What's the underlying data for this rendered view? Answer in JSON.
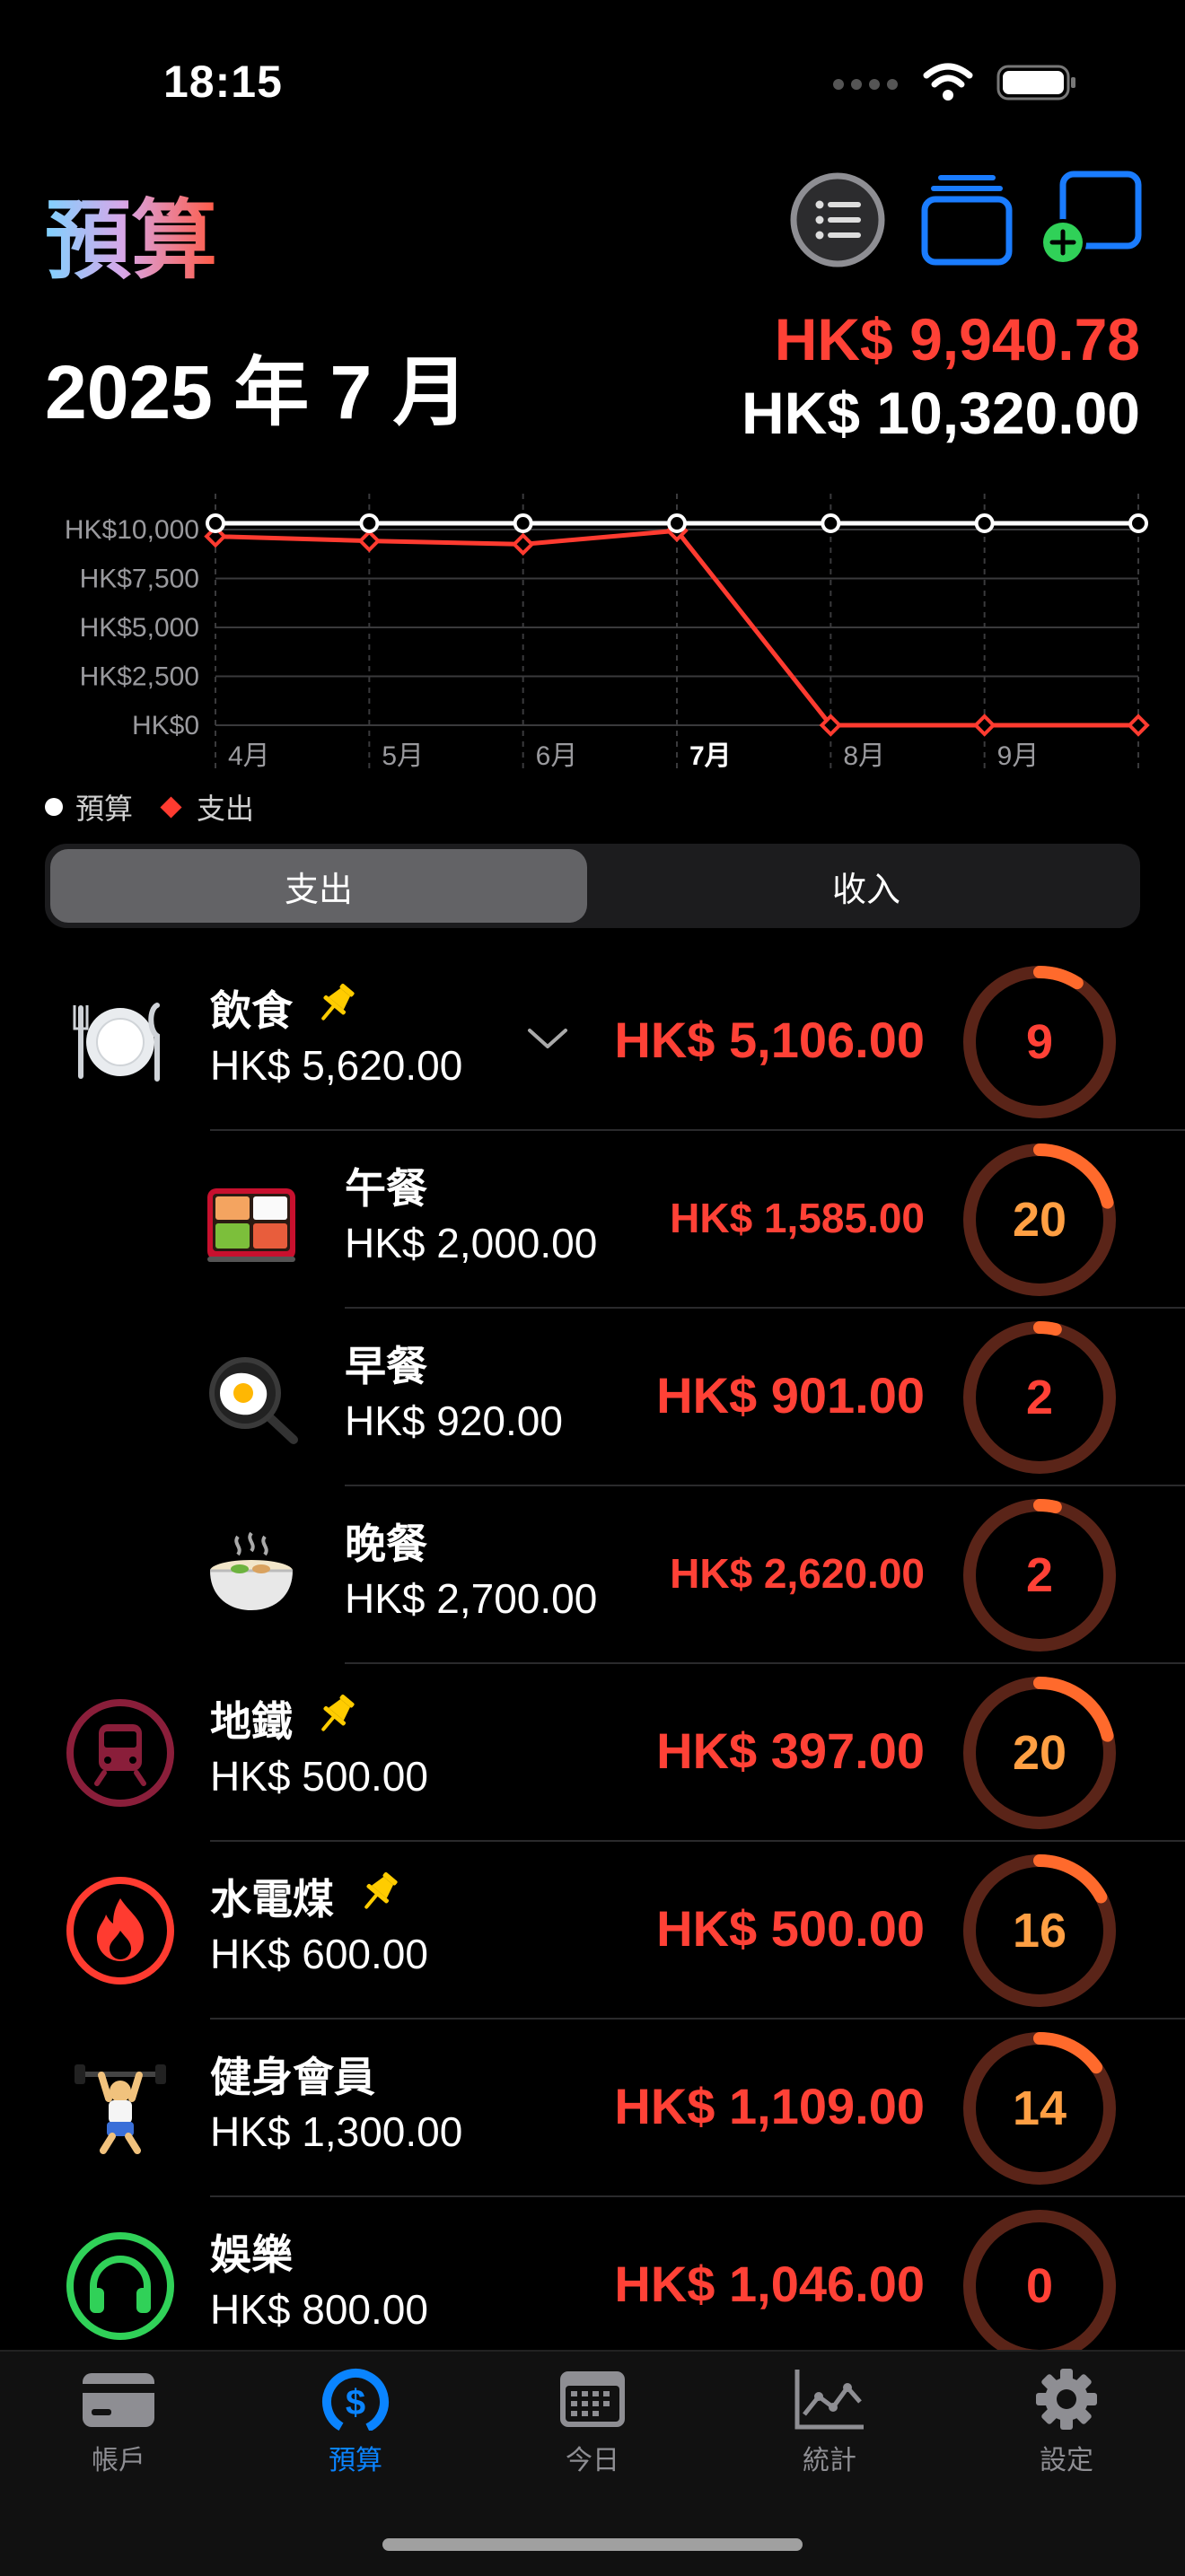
{
  "status": {
    "time": "18:15"
  },
  "header": {
    "title": "預算",
    "month": "2025 年 7 月",
    "spent_total": "HK$ 9,940.78",
    "budget_total": "HK$ 10,320.00",
    "buttons": {
      "list": "list-icon",
      "cards": "stack-icon",
      "add": "add-window-icon"
    }
  },
  "colors": {
    "accent": "#0a84ff",
    "spent": "#ff4136",
    "ring_track": "#5a2418",
    "ring_fg": "#ff6a2c",
    "bg": "#000000"
  },
  "chart_data": {
    "type": "line",
    "categories": [
      "4月",
      "5月",
      "6月",
      "7月",
      "8月",
      "9月"
    ],
    "series": [
      {
        "name": "預算",
        "values": [
          10320,
          10320,
          10320,
          10320,
          10320,
          10320,
          10320
        ],
        "color": "#ffffff"
      },
      {
        "name": "支出",
        "values": [
          9650,
          9420,
          9250,
          9940.78,
          0,
          0,
          0
        ],
        "color": "#ff3b30"
      }
    ],
    "y_ticks": [
      "HK$10,000",
      "HK$7,500",
      "HK$5,000",
      "HK$2,500",
      "HK$0"
    ],
    "ylim": [
      0,
      10000
    ],
    "highlight_category": "7月",
    "grid": true
  },
  "legend": {
    "budget": "預算",
    "spent": "支出"
  },
  "segment": {
    "expense": "支出",
    "income": "收入",
    "selected": "支出"
  },
  "categories": [
    {
      "name": "飲食",
      "budget": "HK$ 5,620.00",
      "spent": "HK$ 5,106.00",
      "days": "9",
      "progress": 0.09,
      "pinned": true,
      "expandable": true,
      "icon": "plate-icon"
    },
    {
      "name": "午餐",
      "budget": "HK$ 2,000.00",
      "spent": "HK$ 1,585.00",
      "days": "20",
      "progress": 0.21,
      "sub": true,
      "icon": "bento-icon"
    },
    {
      "name": "早餐",
      "budget": "HK$ 920.00",
      "spent": "HK$ 901.00",
      "days": "2",
      "progress": 0.02,
      "sub": true,
      "icon": "fried-egg-icon"
    },
    {
      "name": "晚餐",
      "budget": "HK$ 2,700.00",
      "spent": "HK$ 2,620.00",
      "days": "2",
      "progress": 0.03,
      "sub": true,
      "icon": "noodle-bowl-icon"
    },
    {
      "name": "地鐵",
      "budget": "HK$ 500.00",
      "spent": "HK$ 397.00",
      "days": "20",
      "progress": 0.21,
      "pinned": true,
      "icon": "train-icon"
    },
    {
      "name": "水電煤",
      "budget": "HK$ 600.00",
      "spent": "HK$ 500.00",
      "days": "16",
      "progress": 0.17,
      "pinned": true,
      "icon": "flame-icon"
    },
    {
      "name": "健身會員",
      "budget": "HK$ 1,300.00",
      "spent": "HK$ 1,109.00",
      "days": "14",
      "progress": 0.15,
      "icon": "weightlifter-icon"
    },
    {
      "name": "娛樂",
      "budget": "HK$ 800.00",
      "spent": "HK$ 1,046.00",
      "days": "0",
      "progress": 0.0,
      "icon": "headphones-icon"
    }
  ],
  "tabs": [
    {
      "label": "帳戶",
      "icon": "card-icon",
      "active": false
    },
    {
      "label": "預算",
      "icon": "dollar-gauge-icon",
      "active": true
    },
    {
      "label": "今日",
      "icon": "calendar-icon",
      "active": false
    },
    {
      "label": "統計",
      "icon": "chart-icon",
      "active": false
    },
    {
      "label": "設定",
      "icon": "gear-icon",
      "active": false
    }
  ]
}
